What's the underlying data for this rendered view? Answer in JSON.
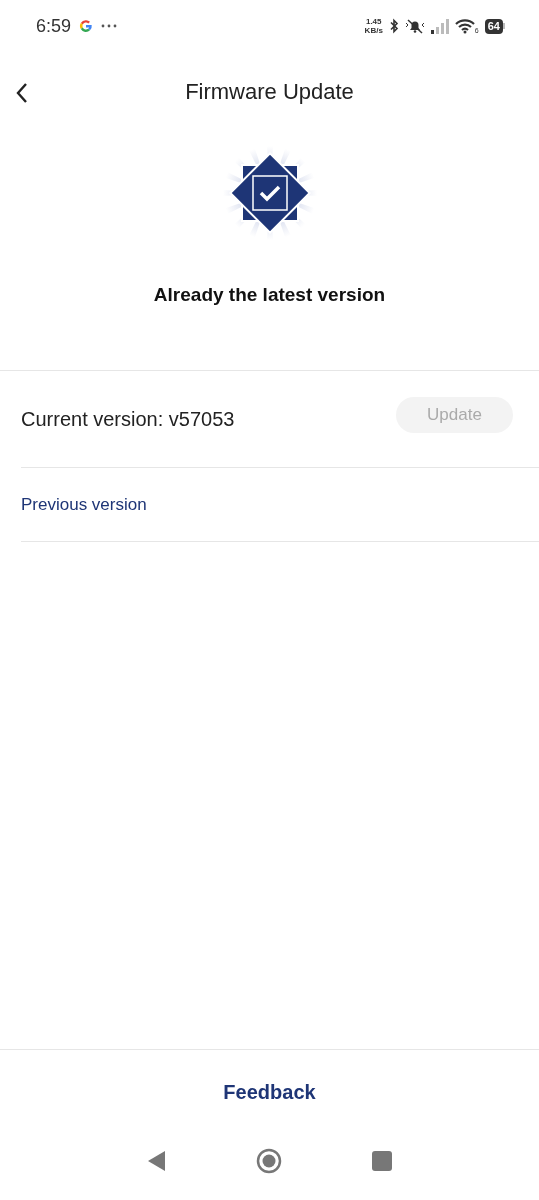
{
  "status_bar": {
    "time": "6:59",
    "speed_value": "1.45",
    "speed_unit": "KB/s",
    "wifi_label": "6",
    "battery": "64"
  },
  "header": {
    "title": "Firmware Update"
  },
  "status": {
    "message": "Already the latest version"
  },
  "current": {
    "label": "Current version: v57053",
    "button": {
      "label": "Update",
      "disabled": true
    }
  },
  "links": [
    {
      "label": "Previous version"
    }
  ],
  "footer": {
    "label": "Feedback"
  }
}
